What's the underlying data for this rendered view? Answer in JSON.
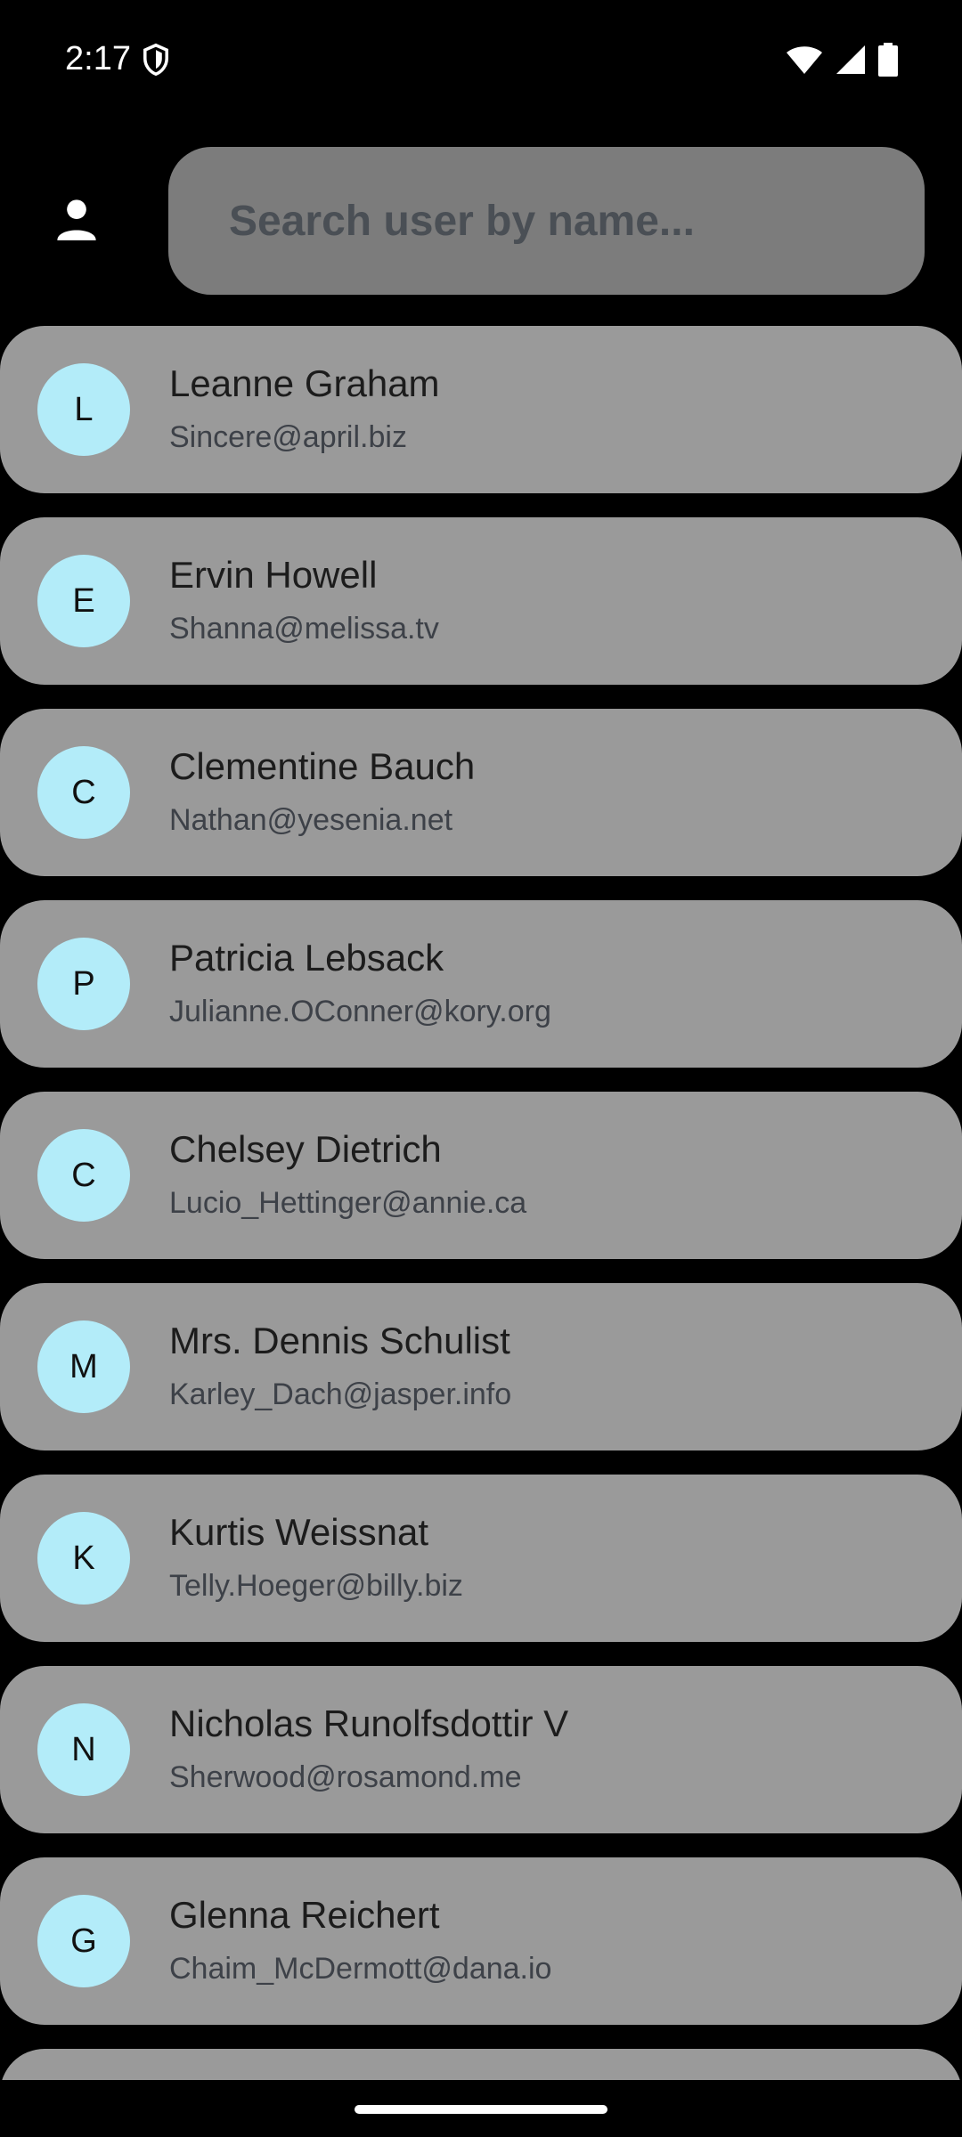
{
  "status_bar": {
    "time": "2:17",
    "icons": [
      "shield-icon",
      "wifi-icon",
      "cellular-signal-icon",
      "battery-icon"
    ]
  },
  "header": {
    "person_icon": "person-icon",
    "search_placeholder": "Search user by name...",
    "search_value": ""
  },
  "colors": {
    "background": "#000000",
    "card": "#9a9a9a",
    "search_field": "#7c7c7c",
    "avatar": "#b3ecf9"
  },
  "users": [
    {
      "initial": "L",
      "name": "Leanne Graham",
      "email": "Sincere@april.biz"
    },
    {
      "initial": "E",
      "name": "Ervin Howell",
      "email": "Shanna@melissa.tv"
    },
    {
      "initial": "C",
      "name": "Clementine Bauch",
      "email": "Nathan@yesenia.net"
    },
    {
      "initial": "P",
      "name": "Patricia Lebsack",
      "email": "Julianne.OConner@kory.org"
    },
    {
      "initial": "C",
      "name": "Chelsey Dietrich",
      "email": "Lucio_Hettinger@annie.ca"
    },
    {
      "initial": "M",
      "name": "Mrs. Dennis Schulist",
      "email": "Karley_Dach@jasper.info"
    },
    {
      "initial": "K",
      "name": "Kurtis Weissnat",
      "email": "Telly.Hoeger@billy.biz"
    },
    {
      "initial": "N",
      "name": "Nicholas Runolfsdottir V",
      "email": "Sherwood@rosamond.me"
    },
    {
      "initial": "G",
      "name": "Glenna Reichert",
      "email": "Chaim_McDermott@dana.io"
    }
  ]
}
